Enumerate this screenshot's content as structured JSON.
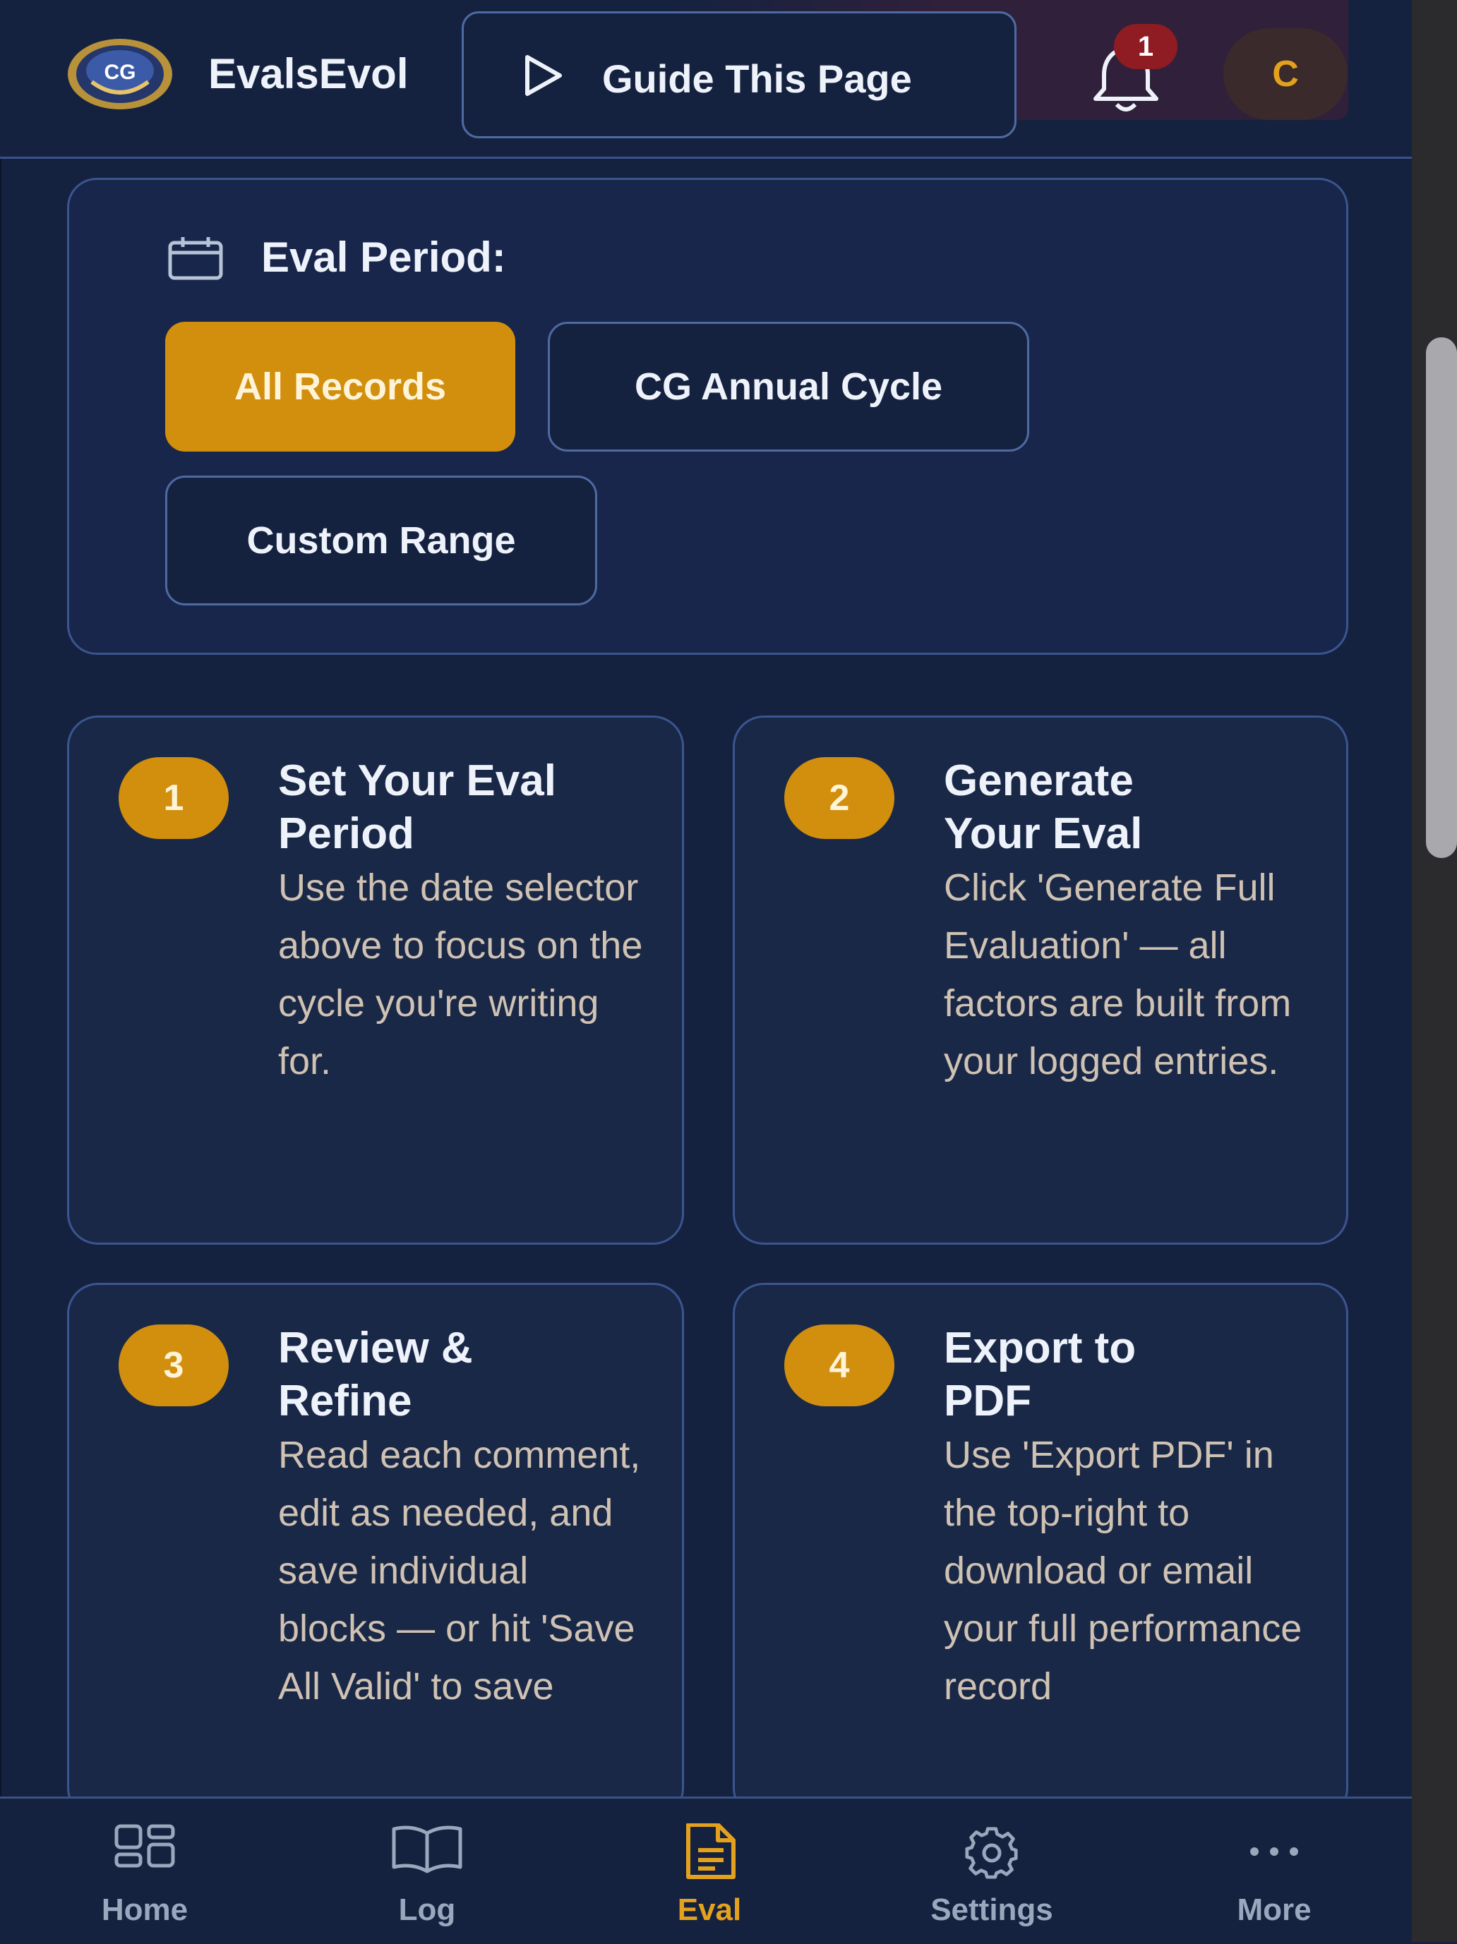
{
  "header": {
    "brand": "EvalsEvol",
    "guide_button": "Guide This Page",
    "notification_count": "1",
    "avatar_initial": "C"
  },
  "period": {
    "label": "Eval Period:",
    "options": [
      {
        "label": "All Records",
        "active": true
      },
      {
        "label": "CG Annual Cycle",
        "active": false
      },
      {
        "label": "Custom Range",
        "active": false
      }
    ]
  },
  "steps": [
    {
      "number": "1",
      "title": "Set Your Eval Period",
      "body": "Use the date selector above to focus on the cycle you're writing for."
    },
    {
      "number": "2",
      "title": "Generate Your Eval",
      "body": "Click 'Generate Full Evaluation' — all factors are built from your logged entries."
    },
    {
      "number": "3",
      "title": "Review & Refine",
      "body": "Read each comment, edit as needed, and save individual blocks — or hit 'Save All Valid' to save"
    },
    {
      "number": "4",
      "title": "Export to PDF",
      "body": "Use 'Export PDF' in the top-right to download or email your full performance record"
    }
  ],
  "nav": [
    {
      "label": "Home",
      "icon": "grid-icon",
      "active": false
    },
    {
      "label": "Log",
      "icon": "book-icon",
      "active": false
    },
    {
      "label": "Eval",
      "icon": "document-icon",
      "active": true
    },
    {
      "label": "Settings",
      "icon": "gear-icon",
      "active": false
    },
    {
      "label": "More",
      "icon": "ellipsis-icon",
      "active": false
    }
  ],
  "colors": {
    "background": "#15223f",
    "accent": "#d18f0d",
    "card": "#1a2847",
    "border": "#3b5590",
    "badge": "#8f1c22"
  }
}
